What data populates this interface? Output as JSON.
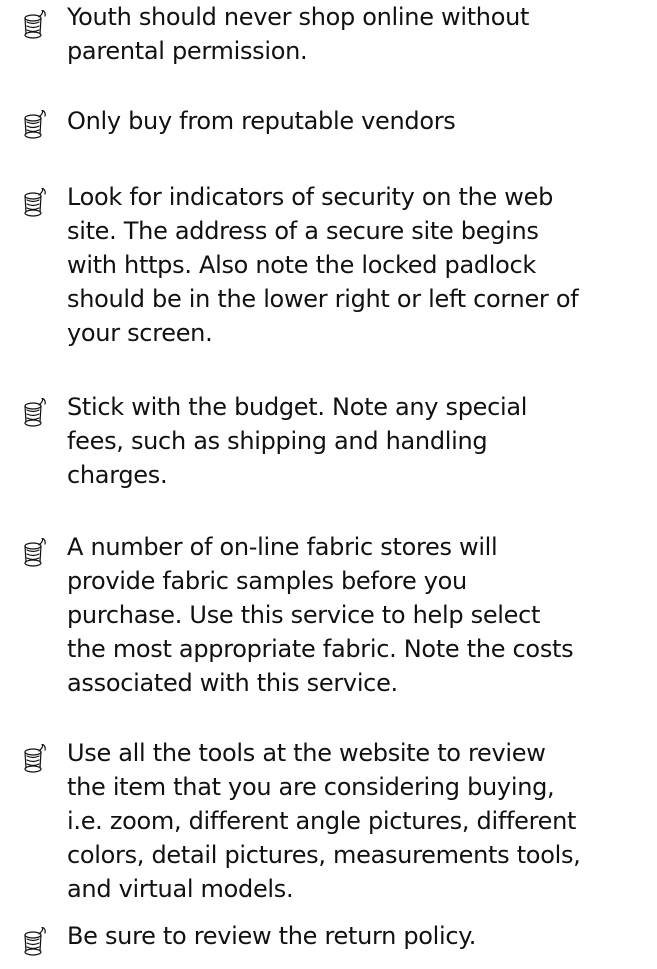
{
  "bullet_icon": "spool-of-thread-icon",
  "tips": [
    {
      "text": "Youth should never shop online without\nparental permission."
    },
    {
      "text": "Only buy from reputable vendors"
    },
    {
      "text": "Look for indicators of security on the web\nsite.  The address of a secure site begins\nwith https.  Also note the locked padlock\nshould be in the lower right or left corner of\nyour screen."
    },
    {
      "text": "Stick with the budget.  Note any special\nfees, such as shipping and handling\ncharges."
    },
    {
      "text": "A number of on-line fabric stores will\nprovide fabric samples before you\npurchase.  Use this service to help select\nthe most appropriate fabric.  Note the costs\nassociated with this service."
    },
    {
      "text": "Use all the tools at the website to review\nthe item that you are considering buying,\ni.e. zoom, different angle pictures, different\ncolors, detail pictures, measurements tools,\nand virtual models."
    },
    {
      "text": "Be sure to review the return policy."
    }
  ]
}
